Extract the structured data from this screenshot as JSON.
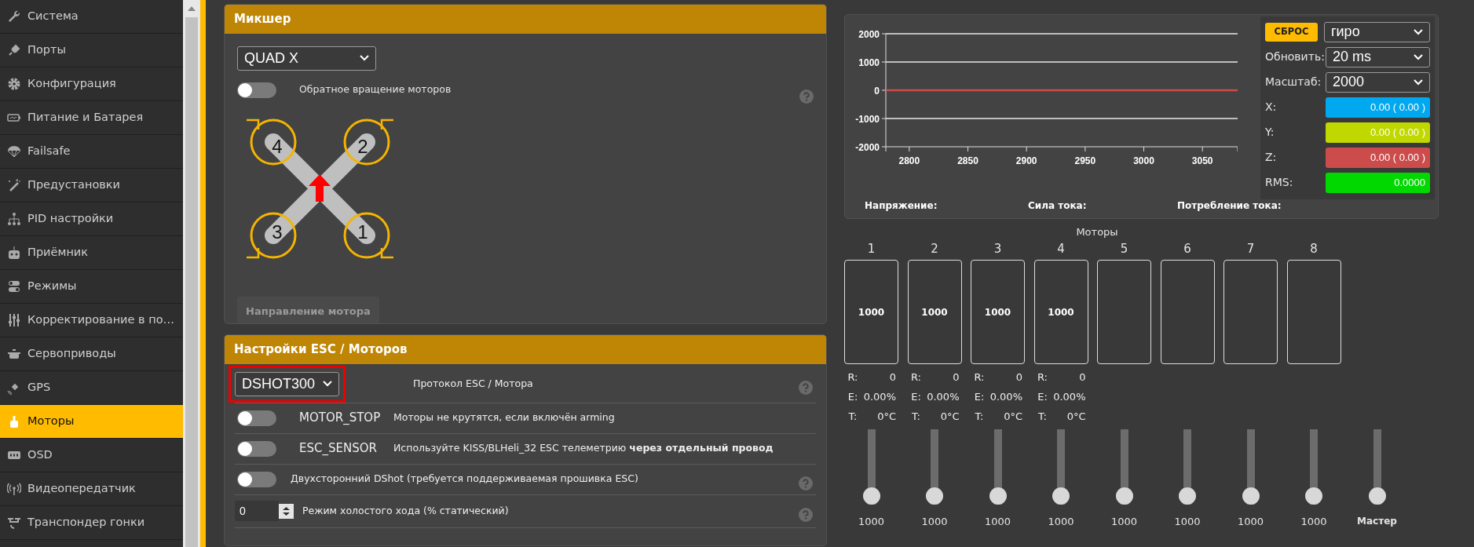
{
  "sidebar": {
    "items": [
      {
        "label": "Система",
        "selected": false
      },
      {
        "label": "Порты",
        "selected": false
      },
      {
        "label": "Конфигурация",
        "selected": false
      },
      {
        "label": "Питание и Батарея",
        "selected": false
      },
      {
        "label": "Failsafe",
        "selected": false
      },
      {
        "label": "Предустановки",
        "selected": false
      },
      {
        "label": "PID настройки",
        "selected": false
      },
      {
        "label": "Приёмник",
        "selected": false
      },
      {
        "label": "Режимы",
        "selected": false
      },
      {
        "label": "Корректирование в по…",
        "selected": false
      },
      {
        "label": "Сервоприводы",
        "selected": false
      },
      {
        "label": "GPS",
        "selected": false
      },
      {
        "label": "Моторы",
        "selected": true
      },
      {
        "label": "OSD",
        "selected": false
      },
      {
        "label": "Видеопередатчик",
        "selected": false
      },
      {
        "label": "Транспондер гонки",
        "selected": false
      }
    ]
  },
  "mixer": {
    "title": "Микшер",
    "mixer_type": "QUAD X",
    "reverse": {
      "label": "Обратное вращение моторов",
      "on": false,
      "help": true
    },
    "diagram": {
      "motor_numbers": [
        "4",
        "2",
        "3",
        "1"
      ]
    },
    "direction_button": {
      "label": "Направление мотора",
      "disabled": true
    }
  },
  "esc": {
    "title": "Настройки ESC / Моторов",
    "rows": [
      {
        "kind": "select",
        "value": "DSHOT300",
        "highlighted": true,
        "label": "Протокол ESC / Мотора",
        "help": true
      },
      {
        "kind": "toggle",
        "on": false,
        "name": "MOTOR_STOP",
        "label": "Моторы не крутятся, если включён arming",
        "help": false
      },
      {
        "kind": "toggle",
        "on": false,
        "name": "ESC_SENSOR",
        "label": "Используйте KISS/BLHeli_32 ESC телеметрию **через отдельный провод**",
        "help": false
      },
      {
        "kind": "toggle",
        "on": false,
        "label": "Двухсторонний DShot (требуется поддерживаемая прошивка ESC)",
        "help": true
      },
      {
        "kind": "number",
        "value": "0",
        "label": "Режим холостого хода (% статический)",
        "help": true
      }
    ]
  },
  "sensor": {
    "reset_button": "СБРОС",
    "sensor_select": "гиро",
    "refresh": {
      "label": "Обновить:",
      "value": "20 ms"
    },
    "scale": {
      "label": "Масштаб:",
      "value": "2000"
    },
    "readouts": [
      {
        "label": "X:",
        "value": "0.00 ( 0.00 )",
        "color": "#00a8f0"
      },
      {
        "label": "Y:",
        "value": "0.00 ( 0.00 )",
        "color": "#c0d800"
      },
      {
        "label": "Z:",
        "value": "0.00 ( 0.00 )",
        "color": "#cc4c4c"
      },
      {
        "label": "RMS:",
        "value": "0.0000",
        "color": "#00d800"
      }
    ],
    "chart_data": {
      "type": "line",
      "x": [
        2780,
        3080
      ],
      "series": [
        {
          "color": "#cc4c4c",
          "values": [
            0,
            0
          ]
        }
      ],
      "xlim": [
        2780,
        3080
      ],
      "ylim": [
        -2000,
        2000
      ],
      "xticks": [
        2800,
        2850,
        2900,
        2950,
        3000,
        3050
      ],
      "yticks": [
        -2000,
        -1000,
        0,
        1000,
        2000
      ]
    },
    "power_labels": [
      "Напряжение:",
      "Сила тока:",
      "Потребление тока:"
    ]
  },
  "motors": {
    "title": "Моторы",
    "items": [
      {
        "number": "1",
        "value": "1000",
        "telemetry": [
          {
            "label": "R:",
            "value": "0"
          },
          {
            "label": "E:",
            "value": "0.00%"
          },
          {
            "label": "T:",
            "value": "0°C"
          }
        ],
        "slider": {
          "level": 0,
          "reading": "1000"
        }
      },
      {
        "number": "2",
        "value": "1000",
        "telemetry": [
          {
            "label": "R:",
            "value": "0"
          },
          {
            "label": "E:",
            "value": "0.00%"
          },
          {
            "label": "T:",
            "value": "0°C"
          }
        ],
        "slider": {
          "level": 0,
          "reading": "1000"
        }
      },
      {
        "number": "3",
        "value": "1000",
        "telemetry": [
          {
            "label": "R:",
            "value": "0"
          },
          {
            "label": "E:",
            "value": "0.00%"
          },
          {
            "label": "T:",
            "value": "0°C"
          }
        ],
        "slider": {
          "level": 0,
          "reading": "1000"
        }
      },
      {
        "number": "4",
        "value": "1000",
        "telemetry": [
          {
            "label": "R:",
            "value": "0"
          },
          {
            "label": "E:",
            "value": "0.00%"
          },
          {
            "label": "T:",
            "value": "0°C"
          }
        ],
        "slider": {
          "level": 0,
          "reading": "1000"
        }
      },
      {
        "number": "5",
        "slider": {
          "level": 0,
          "reading": "1000"
        }
      },
      {
        "number": "6",
        "slider": {
          "level": 0,
          "reading": "1000"
        }
      },
      {
        "number": "7",
        "slider": {
          "level": 0,
          "reading": "1000"
        }
      },
      {
        "number": "8",
        "slider": {
          "level": 0,
          "reading": "1000"
        }
      }
    ],
    "master": {
      "label": "Мастер",
      "level": 0
    }
  }
}
